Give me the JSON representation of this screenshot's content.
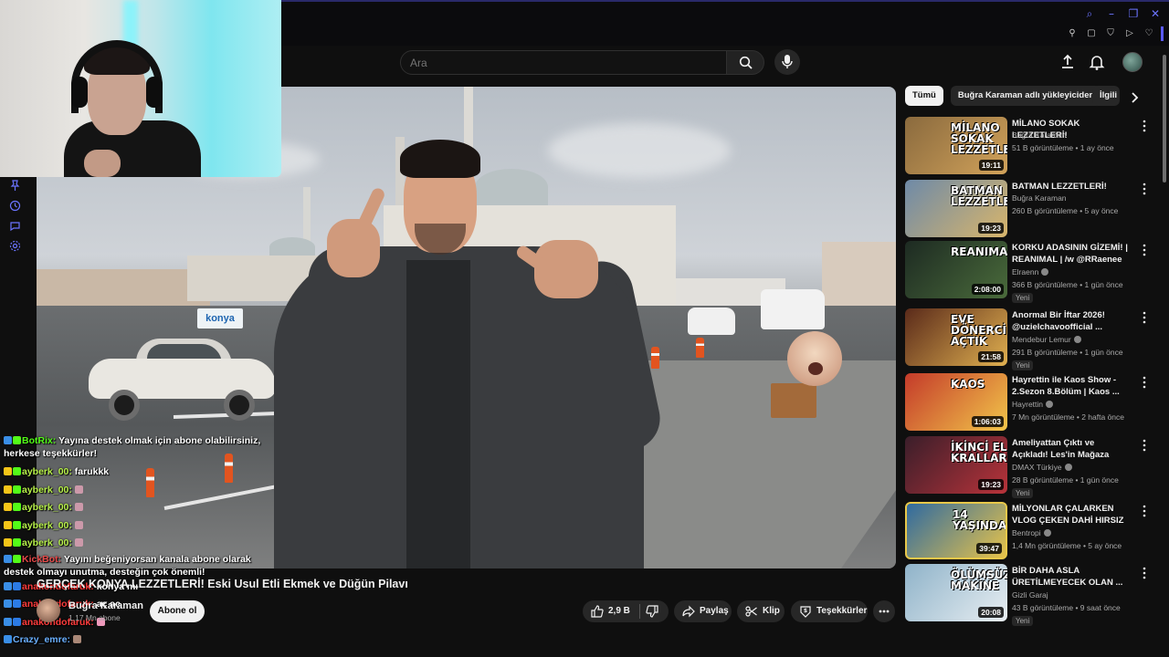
{
  "search": {
    "placeholder": "Ara"
  },
  "video": {
    "title": "GERÇEK KONYA LEZZETLERİ! Eski Usul Etli Ekmek ve Düğün Pilavı",
    "channel": "Buğra Karaman",
    "subscribers": "1,17 Mn abone",
    "subscribe_label": "Abone ol",
    "likes": "2,9 B",
    "share_label": "Paylaş",
    "clip_label": "Klip",
    "thanks_label": "Teşekkürler",
    "overlay_sign": "konya"
  },
  "chat": [
    {
      "user": "BotRix:",
      "text": "Yayına destek olmak için abone olabilirsiniz, herkese teşekkürler!",
      "color": "green"
    },
    {
      "user": "ayberk_00:",
      "text": "farukkk",
      "color": "yellow"
    },
    {
      "user": "ayberk_00:",
      "text": "",
      "color": "yellow"
    },
    {
      "user": "ayberk_00:",
      "text": "",
      "color": "yellow"
    },
    {
      "user": "ayberk_00:",
      "text": "",
      "color": "yellow"
    },
    {
      "user": "ayberk_00:",
      "text": "",
      "color": "yellow"
    },
    {
      "user": "KickBot:",
      "text": "Yayını beğeniyorsan kanala abone olarak destek olmayı unutma, desteğin çok önemli!",
      "color": "red"
    },
    {
      "user": "anakondofaruk:",
      "text": "konya mı",
      "color": "red2"
    },
    {
      "user": "anakondofaruk:",
      "text": "aç aç",
      "color": "red2"
    },
    {
      "user": "anakondofaruk:",
      "text": "",
      "color": "red2"
    },
    {
      "user": "Crazy_emre:",
      "text": "",
      "color": "blue"
    }
  ],
  "chips": [
    "Tümü",
    "Buğra Karaman adlı yükleyiciden",
    "İlgili"
  ],
  "recommendations": [
    {
      "title": "MİLANO SOKAK LEZZETLERİ!",
      "channel": "Buğra Karaman",
      "verified": false,
      "meta": "51 B görüntüleme • 1 ay önce",
      "duration": "19:11",
      "new": "",
      "thumb_text": "MİLANO\nSOKAK LEZZETLERİ",
      "thumb_colors": [
        "#8a6a3e",
        "#d1a25a"
      ]
    },
    {
      "title": "BATMAN LEZZETLERİ!",
      "channel": "Buğra Karaman",
      "verified": false,
      "meta": "260 B görüntüleme • 5 ay önce",
      "duration": "19:23",
      "new": "",
      "thumb_text": "BATMAN\nLEZZETLERİ",
      "thumb_colors": [
        "#6e8aa8",
        "#d8b56b"
      ]
    },
    {
      "title": "KORKU ADASININ GİZEMİ! | REANIMAL | /w @RRaenee ...",
      "channel": "Elraenn",
      "verified": true,
      "meta": "366 B görüntüleme • 1 gün önce",
      "duration": "2:08:00",
      "new": "Yeni",
      "thumb_text": "REANIMAL",
      "thumb_colors": [
        "#1d2a22",
        "#4a6b3b"
      ]
    },
    {
      "title": "Anormal Bir İftar 2026! @uzielchavoofficial ...",
      "channel": "Mendebur Lemur",
      "verified": true,
      "meta": "291 B görüntüleme • 1 gün önce",
      "duration": "21:58",
      "new": "Yeni",
      "thumb_text": "EVE DÖNERCİ AÇTIK",
      "thumb_colors": [
        "#5a2a1a",
        "#e0b050"
      ]
    },
    {
      "title": "Hayrettin ile Kaos Show - 2.Sezon 8.Bölüm | Kaos ...",
      "channel": "Hayrettin",
      "verified": true,
      "meta": "7 Mn görüntüleme • 2 hafta önce",
      "duration": "1:06:03",
      "new": "",
      "thumb_text": "KAOS",
      "thumb_colors": [
        "#c43a2a",
        "#f2c64a"
      ]
    },
    {
      "title": "Ameliyattan Çıktı ve Açıkladı! Les'in Mağaza Karanı | İkinci El...",
      "channel": "DMAX Türkiye",
      "verified": true,
      "meta": "28 B görüntüleme • 1 gün önce",
      "duration": "19:23",
      "new": "Yeni",
      "thumb_text": "İKİNCİ EL KRALLARI",
      "thumb_colors": [
        "#3a1e2a",
        "#b8333a"
      ]
    },
    {
      "title": "MİLYONLAR ÇALARKEN VLOG ÇEKEN DAHİ HIRSIZ",
      "channel": "Bentropi",
      "verified": true,
      "meta": "1,4 Mn görüntüleme • 5 ay önce",
      "duration": "39:47",
      "new": "",
      "thumb_text": "14 YAŞINDA",
      "thumb_colors": [
        "#2f6aa0",
        "#e7c34a"
      ]
    },
    {
      "title": "BİR DAHA ASLA ÜRETİLMEYECEK OLAN ...",
      "channel": "Gizli Garaj",
      "verified": false,
      "meta": "43 B görüntüleme • 9 saat önce",
      "duration": "20:08",
      "new": "Yeni",
      "thumb_text": "ÖLÜMSÜZ MAKİNE",
      "thumb_colors": [
        "#8fb3c9",
        "#e8eef2"
      ]
    }
  ]
}
